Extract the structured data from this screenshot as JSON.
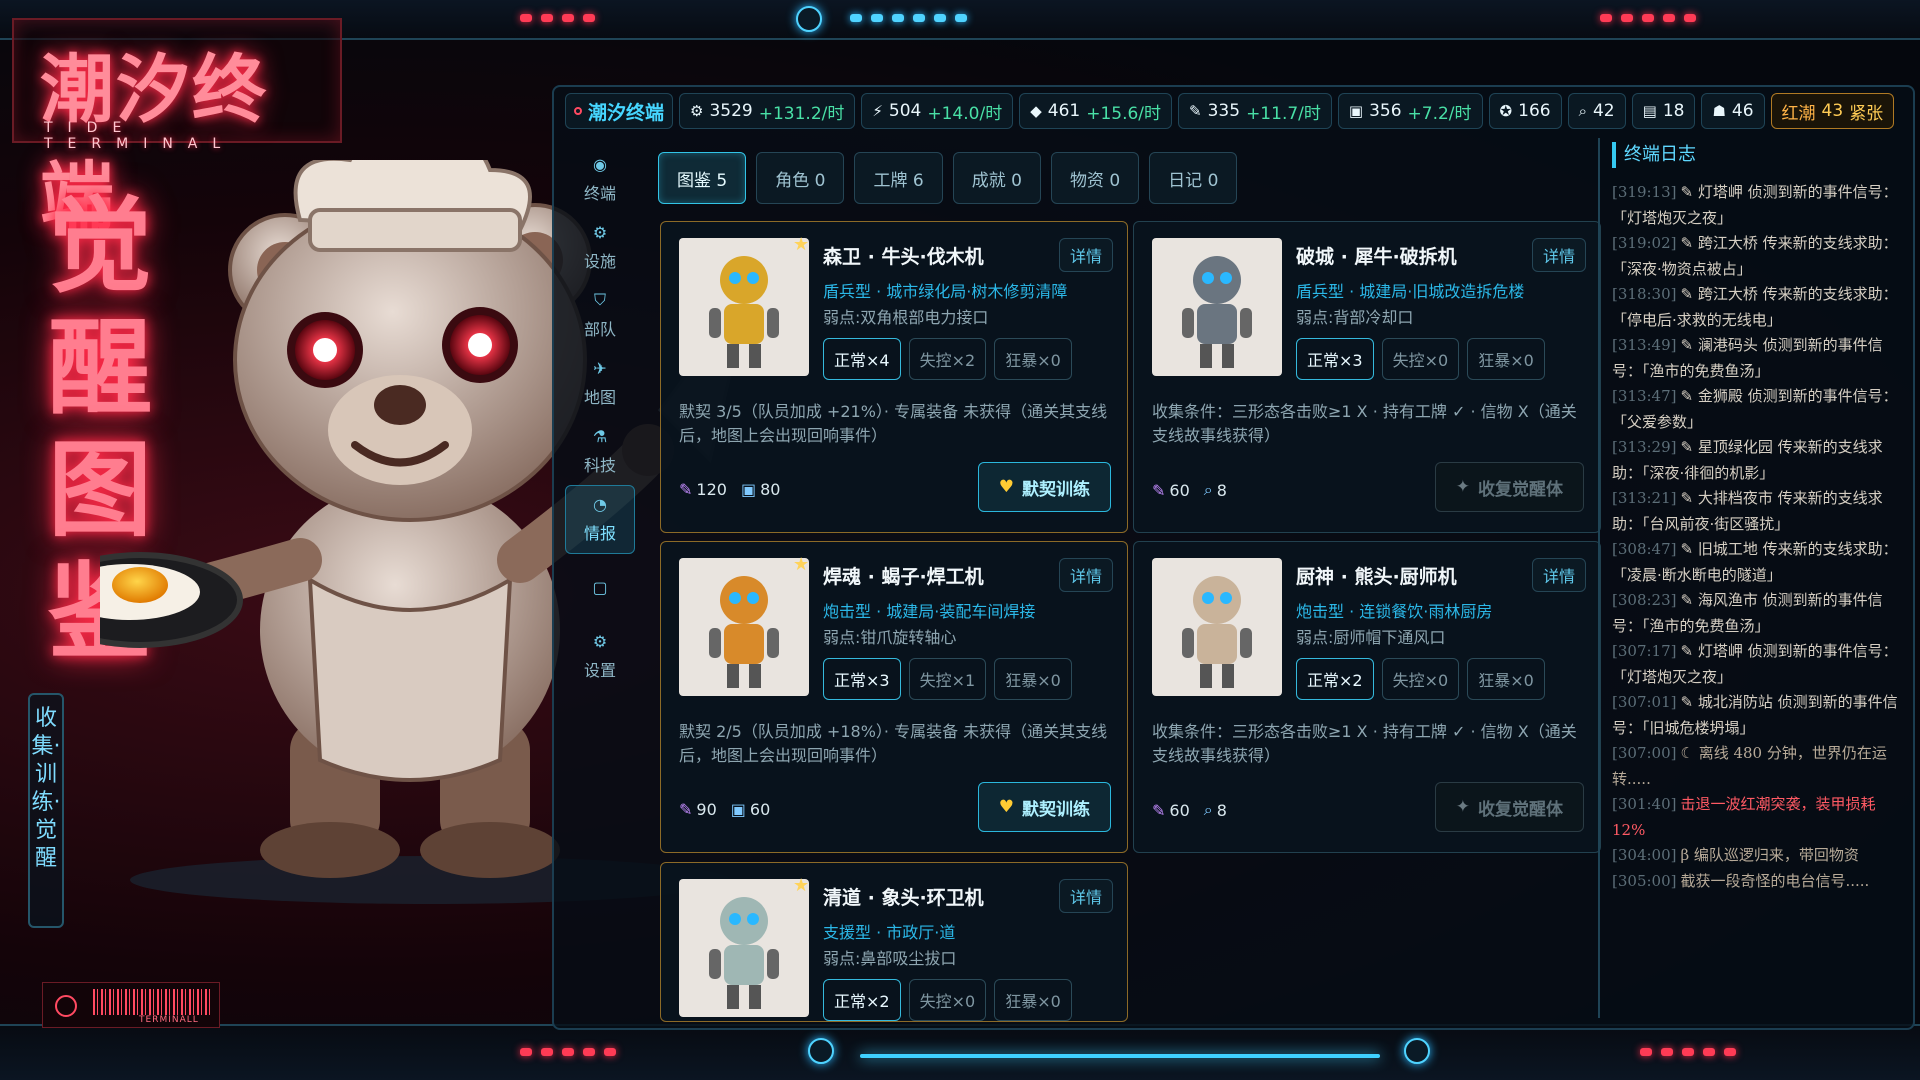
{
  "logo": {
    "cn": "潮汐终端",
    "en": "TIDE TERMINAL"
  },
  "vertical_title": "觉醒图鉴",
  "vertical_subtitle": "收集·训练·觉醒",
  "barcode_text": "TERMINALL",
  "topbar": {
    "brand": "潮汐终端",
    "resources": [
      {
        "icon": "gear-icon",
        "glyph": "⚙",
        "value": "3529",
        "rate": "+131.2/时"
      },
      {
        "icon": "lightning-icon",
        "glyph": "⚡",
        "value": "504",
        "rate": "+14.0/时"
      },
      {
        "icon": "crystal-icon",
        "glyph": "◆",
        "value": "461",
        "rate": "+15.6/时"
      },
      {
        "icon": "syringe-icon",
        "glyph": "✎",
        "value": "335",
        "rate": "+11.7/时"
      },
      {
        "icon": "disk-icon",
        "glyph": "▣",
        "value": "356",
        "rate": "+7.2/时"
      },
      {
        "icon": "medal-icon",
        "glyph": "✪",
        "value": "166",
        "rate": ""
      },
      {
        "icon": "search-icon",
        "glyph": "⌕",
        "value": "42",
        "rate": ""
      },
      {
        "icon": "signal-icon",
        "glyph": "▤",
        "value": "18",
        "rate": ""
      },
      {
        "icon": "people-icon",
        "glyph": "☗",
        "value": "46",
        "rate": ""
      }
    ],
    "alert": {
      "label": "红潮",
      "value": "43",
      "status": "紧张"
    }
  },
  "nav": [
    {
      "icon": "terminal-icon",
      "glyph": "◉",
      "label": "终端"
    },
    {
      "icon": "facility-icon",
      "glyph": "⚙",
      "label": "设施"
    },
    {
      "icon": "squad-icon",
      "glyph": "⛉",
      "label": "部队"
    },
    {
      "icon": "map-icon",
      "glyph": "✈",
      "label": "地图"
    },
    {
      "icon": "tech-icon",
      "glyph": "⚗",
      "label": "科技"
    },
    {
      "icon": "intel-icon",
      "glyph": "◔",
      "label": "情报"
    },
    {
      "icon": "blank-icon",
      "glyph": "▢",
      "label": ""
    },
    {
      "icon": "settings-icon",
      "glyph": "⚙",
      "label": "设置"
    }
  ],
  "tabs": [
    {
      "label": "图鉴 5",
      "active": true
    },
    {
      "label": "角色 0",
      "active": false
    },
    {
      "label": "工牌 6",
      "active": false
    },
    {
      "label": "成就 0",
      "active": false
    },
    {
      "label": "物资 0",
      "active": false
    },
    {
      "label": "日记 0",
      "active": false
    }
  ],
  "cards": [
    {
      "name": "森卫 · 牛头·伐木机",
      "type": "盾兵型 · 城市绿化局·树木修剪清障",
      "weak": "弱点:双角根部电力接口",
      "chips": [
        "正常×4",
        "失控×2",
        "狂暴×0"
      ],
      "desc": "默契 3/5（队员加成 +21%）· 专属装备 未获得（通关其支线后，地图上会出现回响事件）",
      "stat1": "120",
      "stat2": "80",
      "action": "默契训练",
      "active": true,
      "gold": true,
      "detail": "详情",
      "color": "#d9a62a"
    },
    {
      "name": "破城 · 犀牛·破拆机",
      "type": "盾兵型 · 城建局·旧城改造拆危楼",
      "weak": "弱点:背部冷却口",
      "chips": [
        "正常×3",
        "失控×0",
        "狂暴×0"
      ],
      "desc": "收集条件：三形态各击败≥1 X · 持有工牌 ✓ · 信物 X（通关支线故事线获得）",
      "stat1": "60",
      "stat2": "8",
      "action": "收复觉醒体",
      "active": false,
      "gold": false,
      "detail": "详情",
      "color": "#6a7580"
    },
    {
      "name": "焊魂 · 蝎子·焊工机",
      "type": "炮击型 · 城建局·装配车间焊接",
      "weak": "弱点:钳爪旋转轴心",
      "chips": [
        "正常×3",
        "失控×1",
        "狂暴×0"
      ],
      "desc": "默契 2/5（队员加成 +18%）· 专属装备 未获得（通关其支线后，地图上会出现回响事件）",
      "stat1": "90",
      "stat2": "60",
      "action": "默契训练",
      "active": true,
      "gold": true,
      "detail": "详情",
      "color": "#d88a2a"
    },
    {
      "name": "厨神 · 熊头·厨师机",
      "type": "炮击型 · 连锁餐饮·雨林厨房",
      "weak": "弱点:厨师帽下通风口",
      "chips": [
        "正常×2",
        "失控×0",
        "狂暴×0"
      ],
      "desc": "收集条件：三形态各击败≥1 X · 持有工牌 ✓ · 信物 X（通关支线故事线获得）",
      "stat1": "60",
      "stat2": "8",
      "action": "收复觉醒体",
      "active": false,
      "gold": false,
      "detail": "详情",
      "color": "#c9b39a"
    },
    {
      "name": "清道 · 象头·环卫机",
      "type": "支援型 · 市政厅·道",
      "weak": "弱点:鼻部吸尘拔口",
      "chips": [
        "正常×2",
        "失控×0",
        "狂暴×0"
      ],
      "desc": "",
      "stat1": "",
      "stat2": "",
      "action": "",
      "active": true,
      "gold": true,
      "detail": "详情",
      "color": "#9fb7b4"
    }
  ],
  "log": {
    "title": "终端日志",
    "entries": [
      {
        "ts": "[319:13]",
        "text": "✎ 灯塔岬 侦测到新的事件信号：「灯塔炮灭之夜」",
        "kind": "normal"
      },
      {
        "ts": "[319:02]",
        "text": "✎ 跨江大桥 传来新的支线求助：「深夜·物资点被占」",
        "kind": "normal"
      },
      {
        "ts": "[318:30]",
        "text": "✎ 跨江大桥 传来新的支线求助：「停电后·求救的无线电」",
        "kind": "normal"
      },
      {
        "ts": "[313:49]",
        "text": "✎ 澜港码头 侦测到新的事件信号：「渔市的免费鱼汤」",
        "kind": "normal"
      },
      {
        "ts": "[313:47]",
        "text": "✎ 金狮殿 侦测到新的事件信号：「父爱参数」",
        "kind": "normal"
      },
      {
        "ts": "[313:29]",
        "text": "✎ 星顶绿化园 传来新的支线求助：「深夜·徘徊的机影」",
        "kind": "normal"
      },
      {
        "ts": "[313:21]",
        "text": "✎ 大排档夜市 传来新的支线求助：「台风前夜·街区骚扰」",
        "kind": "normal"
      },
      {
        "ts": "[308:47]",
        "text": "✎ 旧城工地 传来新的支线求助：「凌晨·断水断电的隧道」",
        "kind": "normal"
      },
      {
        "ts": "[308:23]",
        "text": "✎ 海风渔市 侦测到新的事件信号：「渔市的免费鱼汤」",
        "kind": "normal"
      },
      {
        "ts": "[307:17]",
        "text": "✎ 灯塔岬 侦测到新的事件信号：「灯塔炮灭之夜」",
        "kind": "normal"
      },
      {
        "ts": "[307:01]",
        "text": "✎ 城北消防站 侦测到新的事件信号：「旧城危楼坍塌」",
        "kind": "normal"
      },
      {
        "ts": "[307:00]",
        "text": "☾ 离线 480 分钟，世界仍在运转.....",
        "kind": "dim"
      },
      {
        "ts": "[301:40]",
        "text": "击退一波红潮突袭，装甲损耗 12%",
        "kind": "warn"
      },
      {
        "ts": "[304:00]",
        "text": "β 编队巡逻归来，带回物资",
        "kind": "dim"
      },
      {
        "ts": "[305:00]",
        "text": "截获一段奇怪的电台信号.....",
        "kind": "dim"
      }
    ]
  },
  "colors": {
    "accent": "#35c9f0",
    "neon_red": "#ff2a48",
    "gold": "#ffcc55",
    "rate_green": "#49e0a6"
  }
}
